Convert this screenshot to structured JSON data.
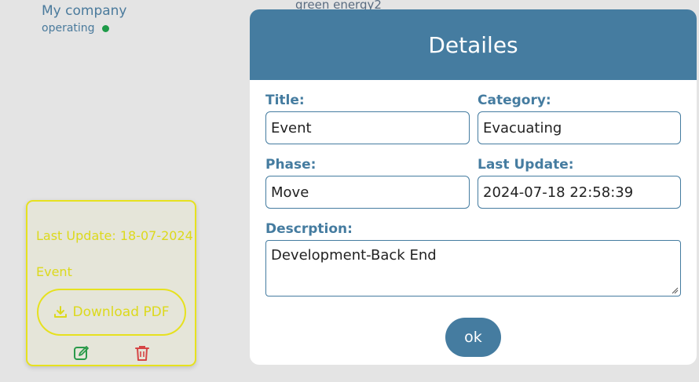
{
  "company": {
    "name": "My company",
    "status": "operating",
    "status_color": "#1e9a48",
    "cut_text": "green energy2"
  },
  "card": {
    "last_update": "Last Update: 18-07-2024",
    "title": "Event",
    "download_label": "Download PDF",
    "accent_color": "#dcd91c",
    "icons": [
      "download-icon",
      "edit-icon",
      "trash-icon"
    ]
  },
  "modal": {
    "title": "Detailes",
    "header_color": "#457ca0",
    "fields": {
      "title": {
        "label": "Title:",
        "value": "Event"
      },
      "category": {
        "label": "Category:",
        "value": "Evacuating"
      },
      "phase": {
        "label": "Phase:",
        "value": "Move"
      },
      "last_update": {
        "label": "Last Update:",
        "value": "2024-07-18 22:58:39"
      },
      "description": {
        "label": "Descrption:",
        "value": "Development-Back End"
      }
    },
    "ok_label": "ok"
  }
}
